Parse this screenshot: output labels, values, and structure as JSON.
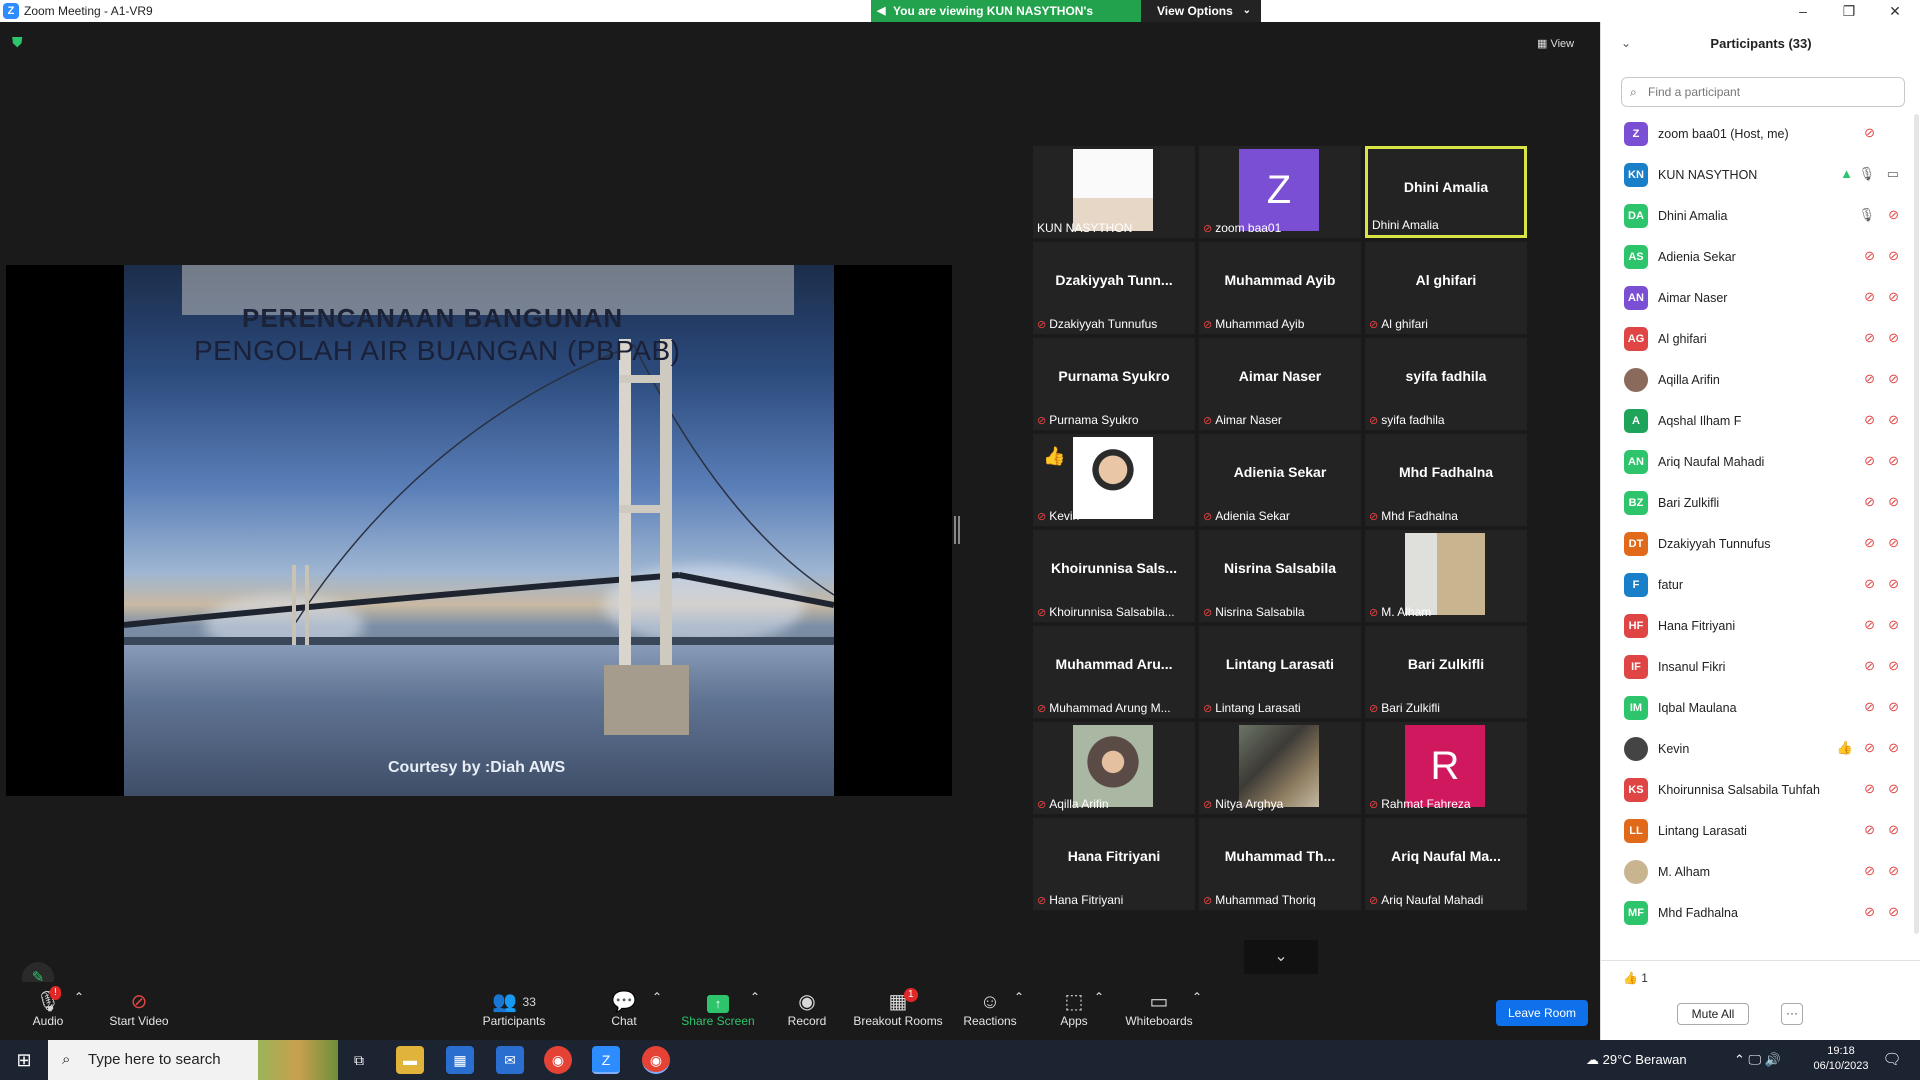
{
  "window": {
    "title": "Zoom Meeting - A1-VR9",
    "viewing_banner": "You are viewing KUN NASYTHON's screen",
    "view_options": "View Options"
  },
  "meeting": {
    "view_label": "View"
  },
  "shared_slide": {
    "title_line1": "PERENCANAAN BANGUNAN",
    "title_line2": "PENGOLAH AIR BUANGAN (PBPAB)",
    "courtesy": "Courtesy by :Diah AWS"
  },
  "gallery": [
    {
      "name": "KUN NASYTHON",
      "label": "KUN NASYTHON",
      "muted": false,
      "video": "slidethumb"
    },
    {
      "name": "Z",
      "label": "zoom baa01",
      "muted": true,
      "avatar": "Z",
      "avatar_color": "#7b4fd4"
    },
    {
      "name": "Dhini Amalia",
      "label": "Dhini Amalia",
      "muted": false,
      "active": true
    },
    {
      "name": "Dzakiyyah Tunn...",
      "label": "Dzakiyyah Tunnufus",
      "muted": true
    },
    {
      "name": "Muhammad Ayib",
      "label": "Muhammad Ayib",
      "muted": true
    },
    {
      "name": "Al ghifari",
      "label": "Al ghifari",
      "muted": true
    },
    {
      "name": "Purnama Syukro",
      "label": "Purnama Syukro",
      "muted": true
    },
    {
      "name": "Aimar Naser",
      "label": "Aimar Naser",
      "muted": true
    },
    {
      "name": "syifa fadhila",
      "label": "syifa fadhila",
      "muted": true
    },
    {
      "name": "Kevin",
      "label": "Kevin",
      "muted": true,
      "video": "face",
      "reaction": "👍"
    },
    {
      "name": "Adienia Sekar",
      "label": "Adienia Sekar",
      "muted": true
    },
    {
      "name": "Mhd Fadhalna",
      "label": "Mhd Fadhalna",
      "muted": true
    },
    {
      "name": "Khoirunnisa Sals...",
      "label": "Khoirunnisa Salsabila...",
      "muted": true
    },
    {
      "name": "Nisrina Salsabila",
      "label": "Nisrina Salsabila",
      "muted": true
    },
    {
      "name": "M. Alham",
      "label": "M. Alham",
      "muted": true,
      "video": "manroom"
    },
    {
      "name": "Muhammad Aru...",
      "label": "Muhammad Arung M...",
      "muted": true
    },
    {
      "name": "Lintang Larasati",
      "label": "Lintang Larasati",
      "muted": true
    },
    {
      "name": "Bari Zulkifli",
      "label": "Bari Zulkifli",
      "muted": true
    },
    {
      "name": "Aqilla Arifin",
      "label": "Aqilla Arifin",
      "muted": true,
      "video": "hijab"
    },
    {
      "name": "Nitya Arghya",
      "label": "Nitya Arghya",
      "muted": true,
      "video": "crowd"
    },
    {
      "name": "R",
      "label": "Rahmat Fahreza",
      "muted": true,
      "avatar": "R",
      "avatar_color": "#d0185e"
    },
    {
      "name": "Hana Fitriyani",
      "label": "Hana Fitriyani",
      "muted": true
    },
    {
      "name": "Muhammad Th...",
      "label": "Muhammad Thoriq",
      "muted": true
    },
    {
      "name": "Ariq Naufal Ma...",
      "label": "Ariq Naufal Mahadi",
      "muted": true
    }
  ],
  "toolbar": {
    "audio": "Audio",
    "audio_badge": "!",
    "start_video": "Start Video",
    "participants": "Participants",
    "participants_count": "33",
    "chat": "Chat",
    "share_screen": "Share Screen",
    "record": "Record",
    "breakout_rooms": "Breakout Rooms",
    "breakout_badge": "1",
    "reactions": "Reactions",
    "apps": "Apps",
    "whiteboards": "Whiteboards",
    "leave_room": "Leave Room"
  },
  "participants_panel": {
    "title": "Participants (33)",
    "search_placeholder": "Find a participant",
    "reaction_count": "1",
    "mute_all": "Mute All",
    "more": "···",
    "list": [
      {
        "initials": "Z",
        "name": "zoom baa01 (Host, me)",
        "color": "#7b4fd4",
        "muted": true,
        "video_off": false
      },
      {
        "initials": "KN",
        "name": "KUN NASYTHON",
        "color": "#1a7fc9",
        "muted": false,
        "video_off": false,
        "sharing": true
      },
      {
        "initials": "DA",
        "name": "Dhini Amalia",
        "color": "#2ec46b",
        "muted": false,
        "video_off": true
      },
      {
        "initials": "AS",
        "name": "Adienia Sekar",
        "color": "#2ec46b",
        "muted": true,
        "video_off": true
      },
      {
        "initials": "AN",
        "name": "Aimar Naser",
        "color": "#7b4fd4",
        "muted": true,
        "video_off": true
      },
      {
        "initials": "AG",
        "name": "Al ghifari",
        "color": "#e04545",
        "muted": true,
        "video_off": true
      },
      {
        "initials": "",
        "name": "Aqilla Arifin",
        "color": "#8a6a5a",
        "muted": true,
        "video_off": true,
        "photo": true
      },
      {
        "initials": "A",
        "name": "Aqshal Ilham F",
        "color": "#1ea35a",
        "muted": true,
        "video_off": true
      },
      {
        "initials": "AN",
        "name": "Ariq Naufal Mahadi",
        "color": "#2ec46b",
        "muted": true,
        "video_off": true
      },
      {
        "initials": "BZ",
        "name": "Bari Zulkifli",
        "color": "#2ec46b",
        "muted": true,
        "video_off": true
      },
      {
        "initials": "DT",
        "name": "Dzakiyyah Tunnufus",
        "color": "#e06a1a",
        "muted": true,
        "video_off": true
      },
      {
        "initials": "F",
        "name": "fatur",
        "color": "#1a7fc9",
        "muted": true,
        "video_off": true
      },
      {
        "initials": "HF",
        "name": "Hana Fitriyani",
        "color": "#e04545",
        "muted": true,
        "video_off": true
      },
      {
        "initials": "IF",
        "name": "Insanul Fikri",
        "color": "#e04545",
        "muted": true,
        "video_off": true
      },
      {
        "initials": "IM",
        "name": "Iqbal Maulana",
        "color": "#2ec46b",
        "muted": true,
        "video_off": true
      },
      {
        "initials": "",
        "name": "Kevin",
        "color": "#444",
        "muted": true,
        "video_off": true,
        "photo": true,
        "reaction": "👍"
      },
      {
        "initials": "KS",
        "name": "Khoirunnisa Salsabila Tuhfah",
        "color": "#e04545",
        "muted": true,
        "video_off": true
      },
      {
        "initials": "LL",
        "name": "Lintang Larasati",
        "color": "#e06a1a",
        "muted": true,
        "video_off": true
      },
      {
        "initials": "",
        "name": "M. Alham",
        "color": "#c8b48f",
        "muted": true,
        "video_off": true,
        "photo": true
      },
      {
        "initials": "MF",
        "name": "Mhd Fadhalna",
        "color": "#2ec46b",
        "muted": true,
        "video_off": true
      }
    ]
  },
  "taskbar": {
    "search_placeholder": "Type here to search",
    "weather": "29°C  Berawan",
    "time": "19:18",
    "date": "06/10/2023"
  }
}
